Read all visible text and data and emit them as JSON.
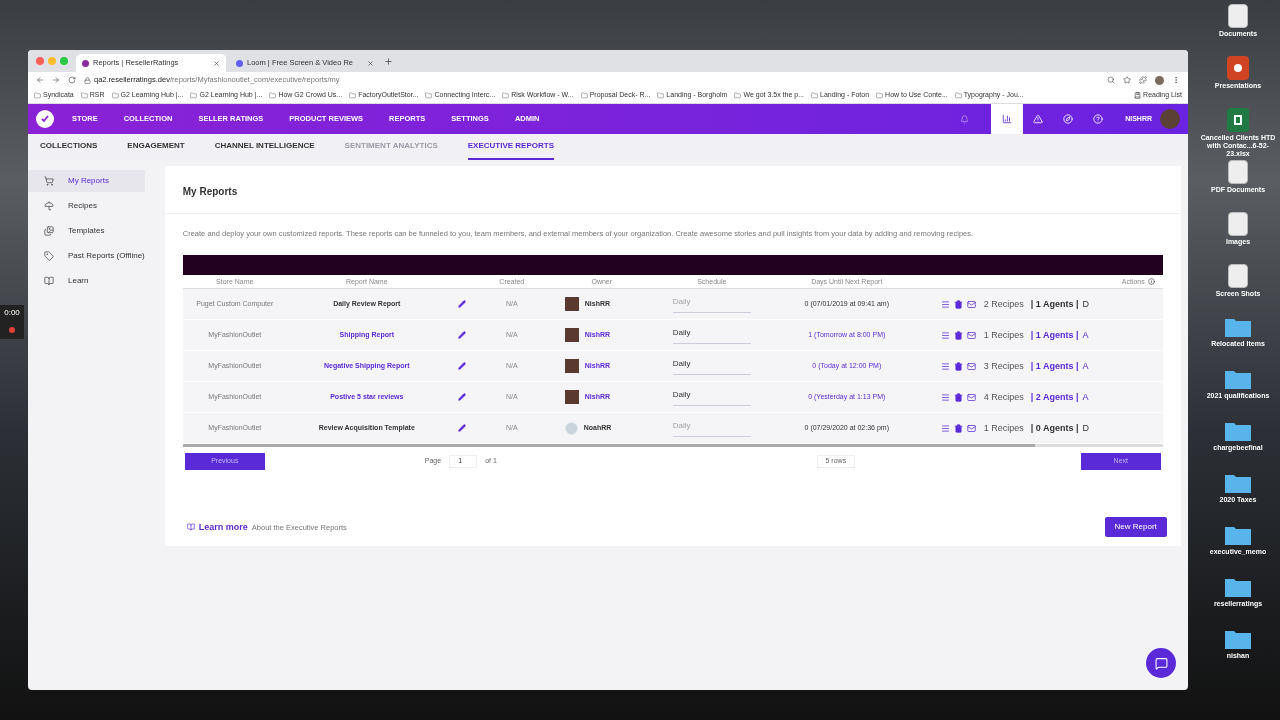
{
  "recorder": {
    "time": "0:00"
  },
  "desktop_icons": [
    {
      "label": "Documents",
      "kind": "doc"
    },
    {
      "label": "Presentations",
      "kind": "ppt"
    },
    {
      "label": "Cancelled Clients HTD with Contac...6-52-23.xlsx",
      "kind": "xls"
    },
    {
      "label": "PDF Documents",
      "kind": "doc"
    },
    {
      "label": "Images",
      "kind": "doc"
    },
    {
      "label": "Screen Shots",
      "kind": "doc"
    },
    {
      "label": "Relocated Items",
      "kind": "folder"
    },
    {
      "label": "2021 qualifications",
      "kind": "folder"
    },
    {
      "label": "chargebeefinal",
      "kind": "folder"
    },
    {
      "label": "2020 Taxes",
      "kind": "folder"
    },
    {
      "label": "executive_memo",
      "kind": "folder"
    },
    {
      "label": "resellerratings",
      "kind": "folder"
    },
    {
      "label": "nishan",
      "kind": "folder"
    }
  ],
  "browser": {
    "tabs": [
      {
        "title": "Reports | ResellerRatings",
        "selected": true
      },
      {
        "title": "Loom | Free Screen & Video Re",
        "selected": false
      }
    ],
    "url_host": "qa2.resellerratings.dev",
    "url_path": "/reports/Myfashionoutlet_com/executive/reports/my",
    "bookmarks": [
      "Syndicata",
      "RSR",
      "G2 Learning Hub |...",
      "G2 Learning Hub |...",
      "How G2 Crowd Us...",
      "FactoryOutletStor...",
      "Connecting Interc...",
      "Risk Workflow - W...",
      "Proposal Deck- R...",
      "Landing - Borgholm",
      "We got 3.5x the p...",
      "Landing - Foton",
      "How to Use Conte...",
      "Typography - Jou..."
    ],
    "reading_list": "Reading List"
  },
  "nav": {
    "items": [
      "STORE",
      "COLLECTION",
      "SELLER RATINGS",
      "PRODUCT REVIEWS",
      "REPORTS",
      "SETTINGS",
      "ADMIN"
    ],
    "user": "NISHRR"
  },
  "subnav": [
    {
      "label": "COLLECTIONS",
      "selected": false,
      "disabled": false
    },
    {
      "label": "ENGAGEMENT",
      "selected": false,
      "disabled": false
    },
    {
      "label": "CHANNEL INTELLIGENCE",
      "selected": false,
      "disabled": false
    },
    {
      "label": "SENTIMENT ANALYTICS",
      "selected": false,
      "disabled": true
    },
    {
      "label": "EXECUTIVE REPORTS",
      "selected": true,
      "disabled": false
    }
  ],
  "sidebar": [
    {
      "label": "My Reports",
      "kind": "cart",
      "selected": true
    },
    {
      "label": "Recipes",
      "kind": "beach",
      "selected": false
    },
    {
      "label": "Templates",
      "kind": "template",
      "selected": false
    },
    {
      "label": "Past Reports (Offline)",
      "kind": "tag",
      "selected": false
    },
    {
      "label": "Learn",
      "kind": "book",
      "selected": false
    }
  ],
  "page": {
    "title": "My Reports",
    "description": "Create and deploy your own customized reports. These reports can be funneled to you, team members, and external members of your organization. Create awesome stories and pull insights from your data by adding and removing recipes."
  },
  "table": {
    "columns": [
      "Store Name",
      "Report Name",
      "Created",
      "Owner",
      "Schedule",
      "Days Until Next Report",
      "Actions"
    ],
    "rows": [
      {
        "store": "Puget Custom Computer",
        "report": "Daily Review Report",
        "created": "N/A",
        "owner": "NishRR",
        "has_photo": true,
        "schedule": "Daily",
        "next": "0 (07/01/2019 at 09:41 am)",
        "recipes": "2 Recipes",
        "agents": "| 1 Agents |",
        "more": "D",
        "active": false
      },
      {
        "store": "MyFashionOutlet",
        "report": "Shipping Report",
        "created": "N/A",
        "owner": "NishRR",
        "has_photo": true,
        "schedule": "Daily",
        "next": "1 (Tomorrow at 8:00 PM)",
        "recipes": "1 Recipes",
        "agents": "| 1 Agents |",
        "more": "A",
        "active": true
      },
      {
        "store": "MyFashionOutlet",
        "report": "Negative Shipping Report",
        "created": "N/A",
        "owner": "NishRR",
        "has_photo": true,
        "schedule": "Daily",
        "next": "0 (Today at 12:00 PM)",
        "recipes": "3 Recipes",
        "agents": "| 1 Agents |",
        "more": "A",
        "active": true
      },
      {
        "store": "MyFashionOutlet",
        "report": "Postive 5 star reviews",
        "created": "N/A",
        "owner": "NishRR",
        "has_photo": true,
        "schedule": "Daily",
        "next": "0 (Yesterday at 1:13 PM)",
        "recipes": "4 Recipes",
        "agents": "| 2 Agents |",
        "more": "A",
        "active": true
      },
      {
        "store": "MyFashionOutlet",
        "report": "Review Acquisition Template",
        "created": "N/A",
        "owner": "NoahRR",
        "has_photo": false,
        "schedule": "Daily",
        "next": "0 (07/29/2020 at 02:36 pm)",
        "recipes": "1 Recipes",
        "agents": "| 0 Agents |",
        "more": "D",
        "active": false
      }
    ]
  },
  "pagination": {
    "previous": "Previous",
    "page_label": "Page",
    "page": "1",
    "of": "of 1",
    "rows": "5 rows",
    "next": "Next"
  },
  "footer": {
    "learn_more": "Learn more",
    "about": "About the Executive Reports",
    "new_report": "New Report"
  }
}
